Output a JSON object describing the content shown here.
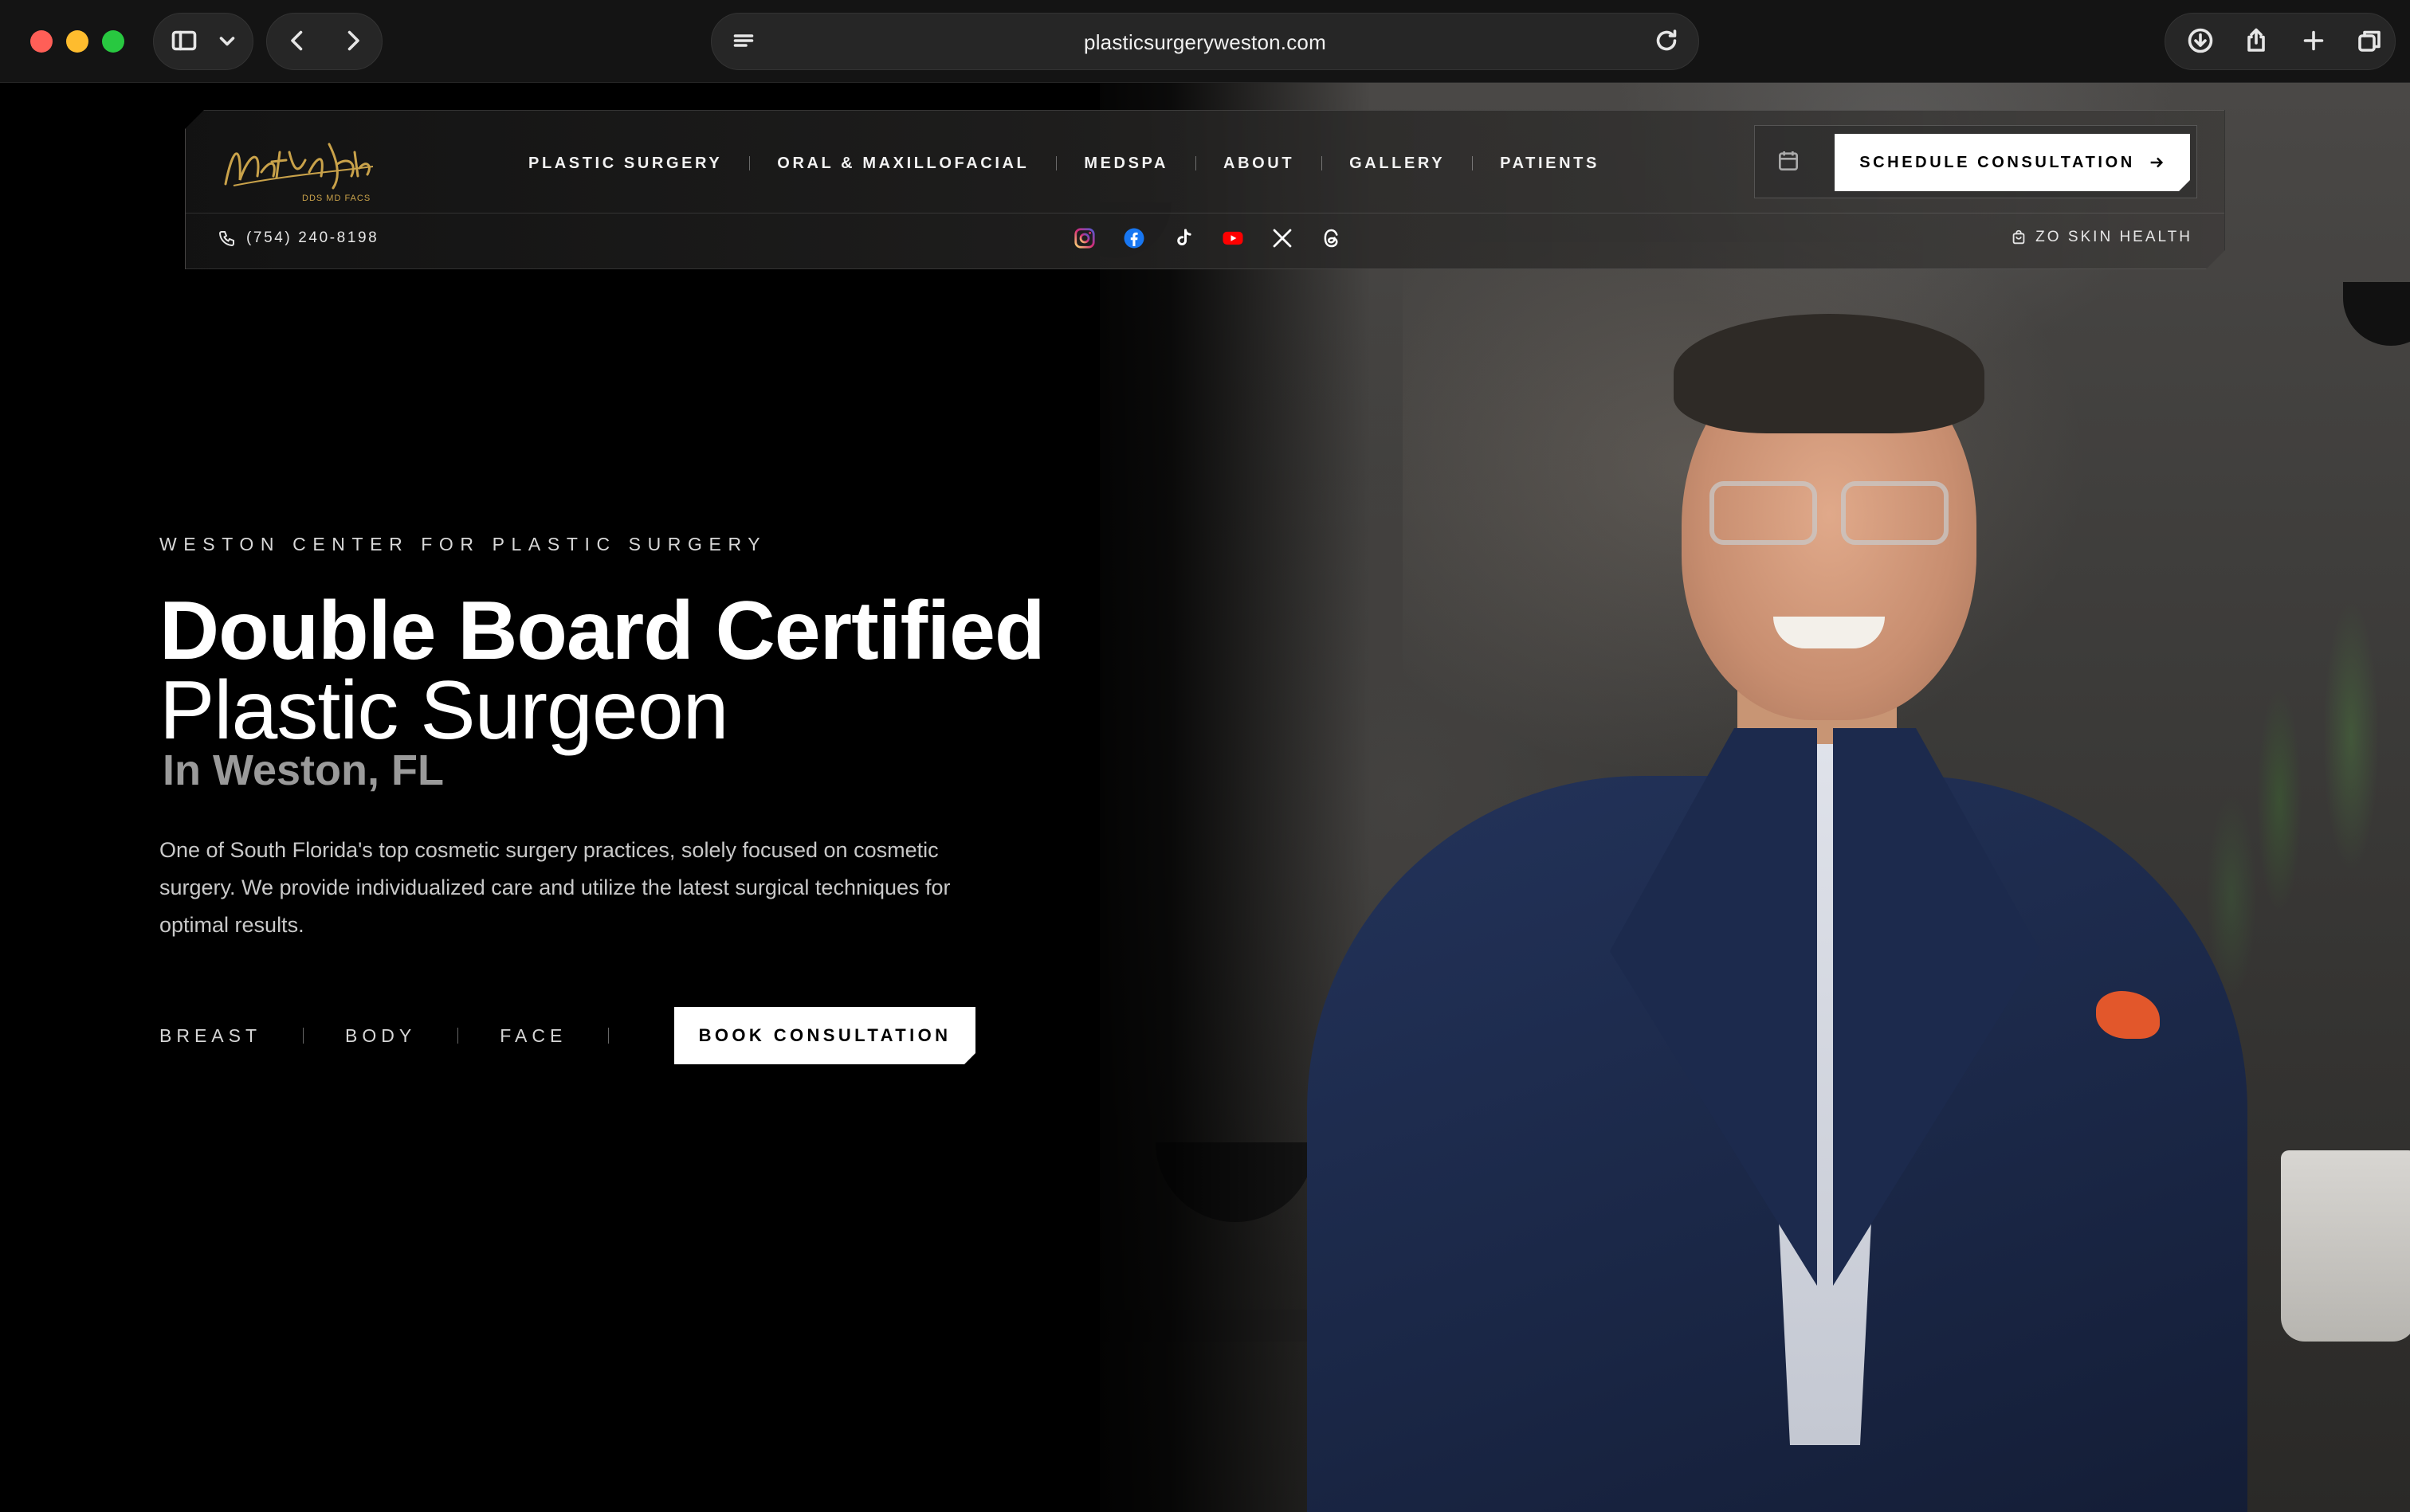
{
  "browser": {
    "url": "plasticsurgeryweston.com"
  },
  "header": {
    "logo_text": "Nathan Eberle",
    "logo_subtext": "DDS MD FACS",
    "nav": [
      {
        "label": "PLASTIC SURGERY"
      },
      {
        "label": "ORAL & MAXILLOFACIAL"
      },
      {
        "label": "MEDSPA"
      },
      {
        "label": "ABOUT"
      },
      {
        "label": "GALLERY"
      },
      {
        "label": "PATIENTS"
      }
    ],
    "cta_label": "SCHEDULE CONSULTATION",
    "phone": "(754) 240-8198",
    "shop_label": "ZO SKIN HEALTH",
    "socials": [
      "instagram-icon",
      "facebook-icon",
      "tiktok-icon",
      "youtube-icon",
      "x-icon",
      "threads-icon"
    ]
  },
  "hero": {
    "eyebrow": "WESTON CENTER FOR PLASTIC SURGERY",
    "title_line1": "Double Board Certified",
    "title_line2": "Plastic Surgeon",
    "title_line3": "In Weston, FL",
    "intro": "One of South Florida's top cosmetic surgery practices, solely focused on cosmetic surgery. We provide individualized care and utilize the latest surgical techniques for optimal results.",
    "links": [
      {
        "label": "BREAST"
      },
      {
        "label": "BODY"
      },
      {
        "label": "FACE"
      }
    ],
    "book_label": "BOOK CONSULTATION"
  },
  "colors": {
    "accent_gold": "#c9a24a",
    "background": "#000000",
    "button_bg": "#ffffff",
    "jacket_navy": "#1b2848",
    "pocket_orange": "#e2572b"
  }
}
